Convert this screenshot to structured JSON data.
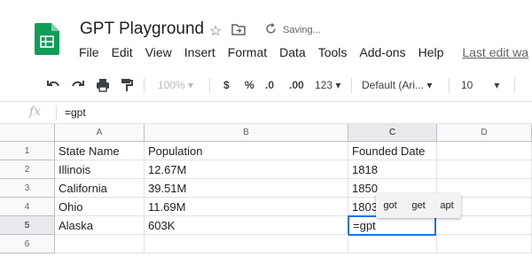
{
  "doc": {
    "title": "GPT Playground",
    "saving": "Saving...",
    "last_edit": "Last edit wa"
  },
  "menu": [
    "File",
    "Edit",
    "View",
    "Insert",
    "Format",
    "Data",
    "Tools",
    "Add-ons",
    "Help"
  ],
  "toolbar": {
    "zoom": "100%",
    "currency": "$",
    "percent": "%",
    "dec_less": ".0",
    "dec_more": ".00",
    "more_formats": "123",
    "font": "Default (Ari...",
    "font_size": "10"
  },
  "formula_bar": {
    "fx": "fx",
    "value": "=gpt"
  },
  "grid": {
    "columns": [
      "A",
      "B",
      "C",
      "D"
    ],
    "rows": [
      "1",
      "2",
      "3",
      "4",
      "5",
      "6"
    ],
    "cells": [
      [
        "State Name",
        "Population",
        "Founded Date",
        ""
      ],
      [
        "Illinois",
        "12.67M",
        "1818",
        ""
      ],
      [
        "California",
        "39.51M",
        "1850",
        ""
      ],
      [
        "Ohio",
        "11.69M",
        "1803",
        ""
      ],
      [
        "Alaska",
        "603K",
        "=gpt",
        ""
      ],
      [
        "",
        "",
        "",
        ""
      ]
    ],
    "active_cell": "C5"
  },
  "autocomplete": [
    "got",
    "get",
    "apt"
  ],
  "colors": {
    "sheets_green": "#0f9d58",
    "selection_blue": "#1a73e8"
  }
}
